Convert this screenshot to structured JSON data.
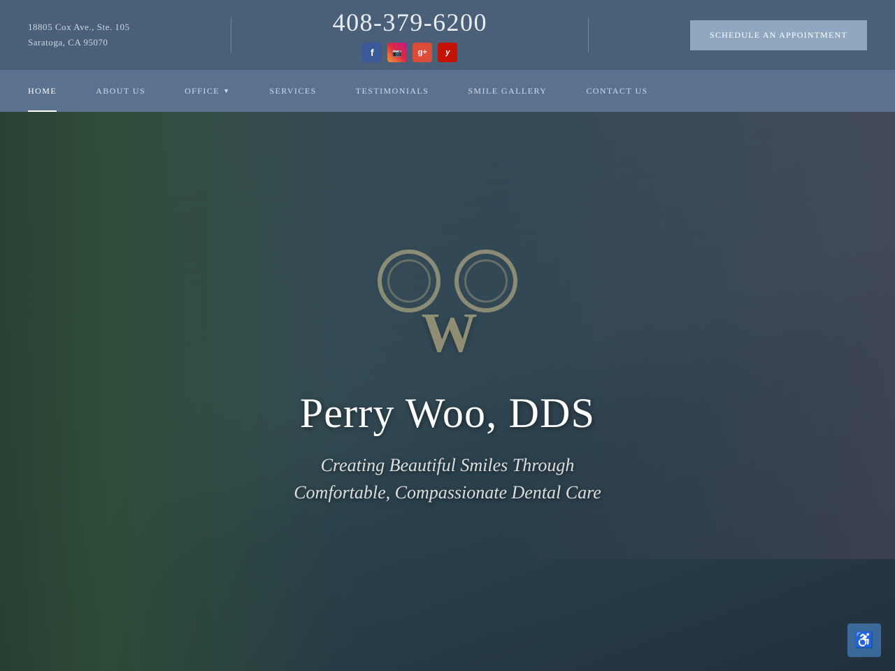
{
  "topbar": {
    "address_line1": "18805 Cox Ave., Ste. 105",
    "address_line2": "Saratoga, CA 95070",
    "phone": "408-379-6200",
    "schedule_btn": "SCHEDULE AN APPOINTMENT",
    "social": [
      {
        "name": "facebook",
        "label": "f"
      },
      {
        "name": "instagram",
        "label": "📷"
      },
      {
        "name": "google",
        "label": "g+"
      },
      {
        "name": "yelp",
        "label": "y"
      }
    ]
  },
  "nav": {
    "items": [
      {
        "label": "HOME",
        "active": true
      },
      {
        "label": "ABOUT US",
        "active": false
      },
      {
        "label": "OFFICE",
        "active": false,
        "dropdown": true
      },
      {
        "label": "SERVICES",
        "active": false
      },
      {
        "label": "TESTIMONIALS",
        "active": false
      },
      {
        "label": "SMILE GALLERY",
        "active": false
      },
      {
        "label": "CONTACT US",
        "active": false
      }
    ]
  },
  "hero": {
    "logo_w": "W",
    "title": "Perry Woo, DDS",
    "subtitle_line1": "Creating Beautiful Smiles Through",
    "subtitle_line2": "Comfortable, Compassionate Dental Care"
  },
  "accessibility": {
    "label": "♿"
  }
}
